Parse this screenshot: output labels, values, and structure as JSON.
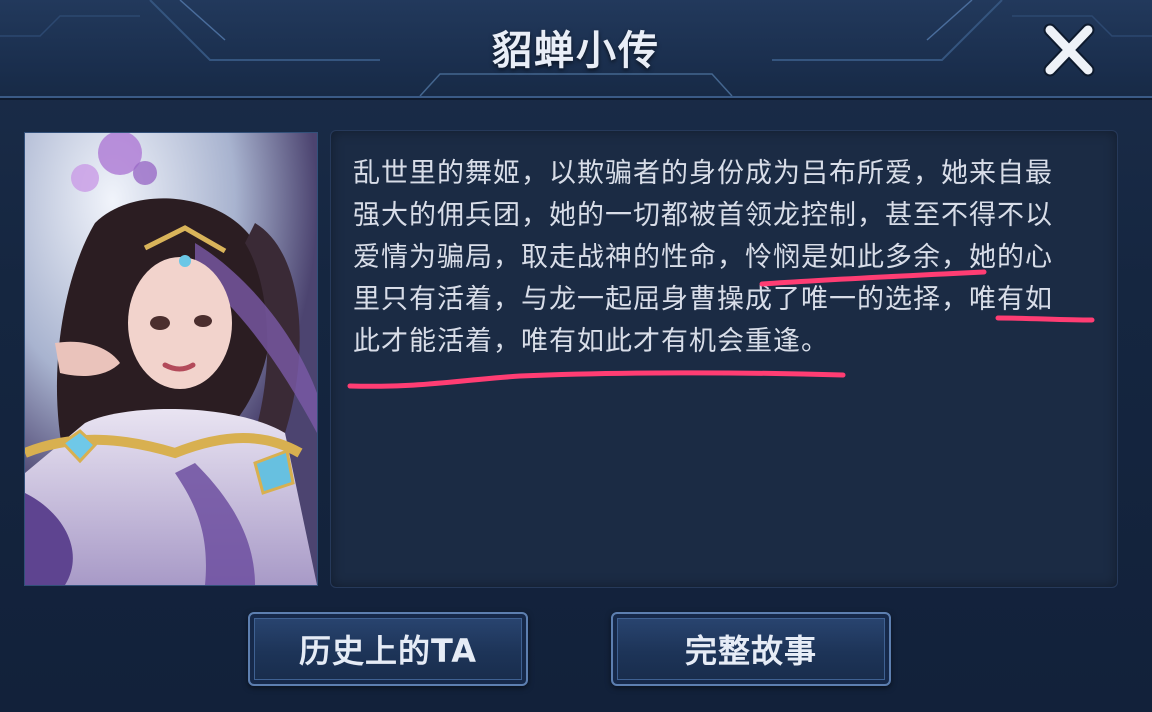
{
  "dialog": {
    "title": "貂蝉小传",
    "close_icon": "close-icon"
  },
  "portrait": {
    "icon": "hero-portrait"
  },
  "story": {
    "lines": [
      "乱世里的舞姬，以欺骗者的身份成为吕布所爱，她来自最",
      "强大的佣兵团，她的一切都被首领龙控制，甚至不得不以",
      "爱情为骗局，取走战神的性命，怜悯是如此多余，她的心",
      "里只有活着，与龙一起屈身曹操成了唯一的选择，唯有如",
      "此才能活着，唯有如此才有机会重逢。"
    ],
    "highlight_color": "#ff3d73"
  },
  "buttons": {
    "history_label": "历史上的TA",
    "full_story_label": "完整故事"
  }
}
